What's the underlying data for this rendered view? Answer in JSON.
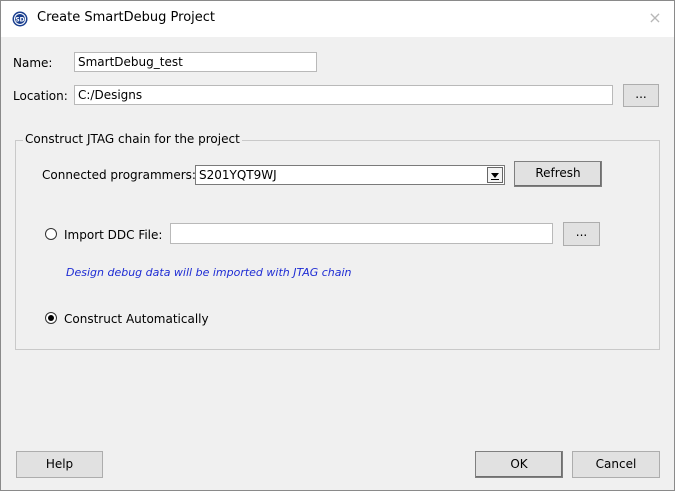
{
  "window": {
    "title": "Create SmartDebug Project",
    "close_glyph": "×",
    "app_icon": "smartdebug-logo-icon"
  },
  "name": {
    "label": "Name:",
    "value": "SmartDebug_test"
  },
  "location": {
    "label": "Location:",
    "value": "C:/Designs",
    "browse_label": "..."
  },
  "jtag_group": {
    "legend": "Construct JTAG chain for the project",
    "programmers_label": "Connected programmers:",
    "programmer_selected": "S201YQT9WJ",
    "refresh_label": "Refresh",
    "import_ddc": {
      "label": "Import DDC File:",
      "value": "",
      "browse_label": "...",
      "checked": false
    },
    "hint": "Design debug data will be imported with JTAG chain",
    "construct_auto": {
      "label": "Construct Automatically",
      "checked": true
    }
  },
  "footer": {
    "help_label": "Help",
    "ok_label": "OK",
    "cancel_label": "Cancel"
  },
  "colors": {
    "hint": "#1e2cd4",
    "background": "#f0f0f0",
    "titlebar": "#ffffff"
  }
}
